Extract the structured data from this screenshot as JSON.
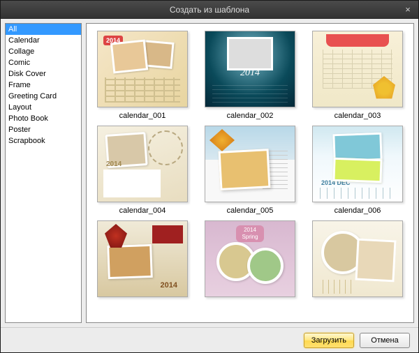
{
  "window": {
    "title": "Создать из шаблона"
  },
  "sidebar": {
    "items": [
      {
        "label": "All",
        "selected": true
      },
      {
        "label": "Calendar",
        "selected": false
      },
      {
        "label": "Collage",
        "selected": false
      },
      {
        "label": "Comic",
        "selected": false
      },
      {
        "label": "Disk Cover",
        "selected": false
      },
      {
        "label": "Frame",
        "selected": false
      },
      {
        "label": "Greeting Card",
        "selected": false
      },
      {
        "label": "Layout",
        "selected": false
      },
      {
        "label": "Photo Book",
        "selected": false
      },
      {
        "label": "Poster",
        "selected": false
      },
      {
        "label": "Scrapbook",
        "selected": false
      }
    ]
  },
  "gallery": {
    "items": [
      {
        "label": "calendar_001",
        "year": "2014"
      },
      {
        "label": "calendar_002",
        "year": "2014"
      },
      {
        "label": "calendar_003",
        "year": ""
      },
      {
        "label": "calendar_004",
        "year": "2014"
      },
      {
        "label": "calendar_005",
        "year": ""
      },
      {
        "label": "calendar_006",
        "year": "2014 DEC"
      },
      {
        "label": "",
        "year": "2014"
      },
      {
        "label": "",
        "year": "2014 Spring"
      },
      {
        "label": "",
        "year": ""
      }
    ]
  },
  "footer": {
    "load_label": "Загрузить",
    "cancel_label": "Отмена"
  }
}
